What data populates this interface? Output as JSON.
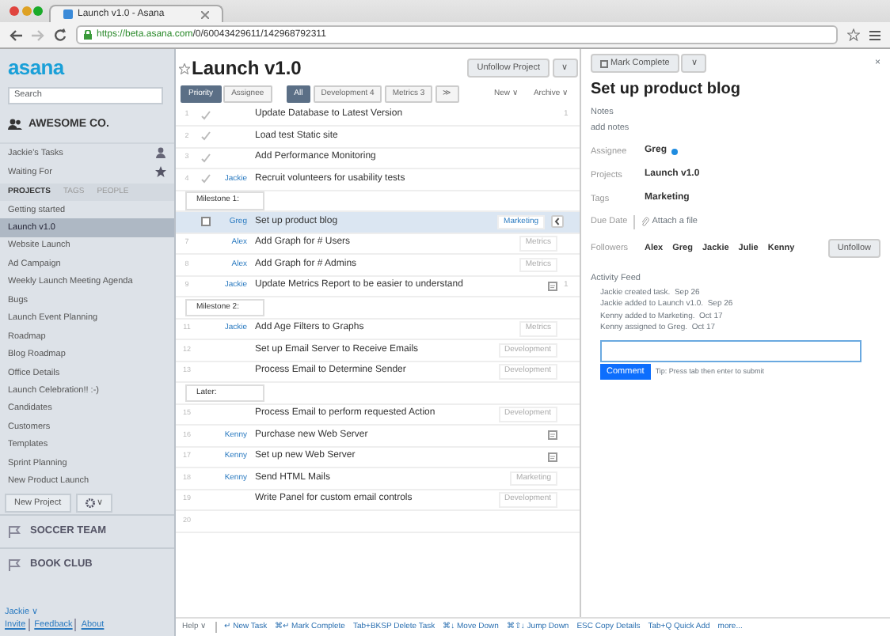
{
  "browser": {
    "tab_title": "Launch v1.0 - Asana",
    "url_host": "https://beta.asana.com",
    "url_path": "/0/60043429611/142968792311"
  },
  "sidebar": {
    "logo": "asana",
    "search": {
      "placeholder": "Search"
    },
    "workspace": "AWESOME CO.",
    "links": [
      {
        "label": "Jackie's Tasks"
      },
      {
        "label": "Waiting For"
      }
    ],
    "tabs": [
      {
        "label": "PROJECTS",
        "selected": true
      },
      {
        "label": "TAGS",
        "selected": false
      },
      {
        "label": "PEOPLE",
        "selected": false
      }
    ],
    "projects": [
      {
        "label": "Getting started",
        "selected": false
      },
      {
        "label": "Launch v1.0",
        "selected": true
      },
      {
        "label": "Website Launch",
        "selected": false
      },
      {
        "label": "Ad Campaign",
        "selected": false
      },
      {
        "label": "Weekly Launch Meeting Agenda",
        "selected": false
      },
      {
        "label": "Bugs",
        "selected": false
      },
      {
        "label": "Launch Event Planning",
        "selected": false
      },
      {
        "label": "Roadmap",
        "selected": false
      },
      {
        "label": "Blog Roadmap",
        "selected": false
      },
      {
        "label": "Office Details",
        "selected": false
      },
      {
        "label": "Launch Celebration!! :-)",
        "selected": false
      },
      {
        "label": "Candidates",
        "selected": false
      },
      {
        "label": "Customers",
        "selected": false
      },
      {
        "label": "Templates",
        "selected": false
      },
      {
        "label": "Sprint Planning",
        "selected": false
      },
      {
        "label": "New Product Launch",
        "selected": false
      }
    ],
    "new_project": "New Project",
    "gear_caret": "∨",
    "other_workspaces": [
      "SOCCER TEAM",
      "BOOK CLUB"
    ],
    "user": "Jackie ∨",
    "footer_links": [
      "Invite",
      "Feedback",
      "About"
    ]
  },
  "project": {
    "title": "Launch v1.0",
    "follow_button": "Unfollow Project",
    "menu_caret": "∨",
    "sort": [
      {
        "label": "Priority",
        "selected": true
      },
      {
        "label": "Assignee",
        "selected": false
      }
    ],
    "filters": [
      {
        "label": "All",
        "selected": true
      },
      {
        "label": "Development 4",
        "selected": false
      },
      {
        "label": "Metrics 3",
        "selected": false
      }
    ],
    "more": "≫",
    "actions": [
      "New ∨",
      "Archive ∨"
    ],
    "rows": [
      {
        "kind": "task",
        "number": "1",
        "checkmark": true,
        "selected": false,
        "assignee": "",
        "name": "Update Database to Latest Version",
        "tag": "",
        "attachment": false,
        "count": "1"
      },
      {
        "kind": "task",
        "number": "2",
        "checkmark": true,
        "selected": false,
        "assignee": "",
        "name": "Load test Static site",
        "tag": "",
        "attachment": false,
        "count": ""
      },
      {
        "kind": "task",
        "number": "3",
        "checkmark": true,
        "selected": false,
        "assignee": "",
        "name": "Add Performance Monitoring",
        "tag": "",
        "attachment": false,
        "count": ""
      },
      {
        "kind": "task",
        "number": "4",
        "checkmark": true,
        "selected": false,
        "assignee": "Jackie",
        "name": "Recruit volunteers for usability tests",
        "tag": "",
        "attachment": false,
        "count": ""
      },
      {
        "kind": "section",
        "name": "Milestone 1:"
      },
      {
        "kind": "task",
        "number": "",
        "checkmark": false,
        "selected": true,
        "assignee": "Greg",
        "name": "Set up product blog",
        "tag": "Marketing",
        "attachment": false,
        "count": ""
      },
      {
        "kind": "task",
        "number": "7",
        "checkmark": false,
        "selected": false,
        "assignee": "Alex",
        "name": "Add Graph for # Users",
        "tag": "Metrics",
        "attachment": false,
        "count": ""
      },
      {
        "kind": "task",
        "number": "8",
        "checkmark": false,
        "selected": false,
        "assignee": "Alex",
        "name": "Add Graph for # Admins",
        "tag": "Metrics",
        "attachment": false,
        "count": ""
      },
      {
        "kind": "task",
        "number": "9",
        "checkmark": false,
        "selected": false,
        "assignee": "Jackie",
        "name": "Update Metrics Report to be easier to understand",
        "tag": "",
        "attachment": true,
        "count": "1"
      },
      {
        "kind": "section",
        "name": "Milestone 2:"
      },
      {
        "kind": "task",
        "number": "11",
        "checkmark": false,
        "selected": false,
        "assignee": "Jackie",
        "name": "Add Age Filters to Graphs",
        "tag": "Metrics",
        "attachment": false,
        "count": ""
      },
      {
        "kind": "task",
        "number": "12",
        "checkmark": false,
        "selected": false,
        "assignee": "",
        "name": "Set up Email Server to Receive Emails",
        "tag": "Development",
        "attachment": false,
        "count": ""
      },
      {
        "kind": "task",
        "number": "13",
        "checkmark": false,
        "selected": false,
        "assignee": "",
        "name": "Process Email to Determine Sender",
        "tag": "Development",
        "attachment": false,
        "count": ""
      },
      {
        "kind": "section",
        "name": "Later:"
      },
      {
        "kind": "task",
        "number": "15",
        "checkmark": false,
        "selected": false,
        "assignee": "",
        "name": "Process Email to perform requested Action",
        "tag": "Development",
        "attachment": false,
        "count": ""
      },
      {
        "kind": "task",
        "number": "16",
        "checkmark": false,
        "selected": false,
        "assignee": "Kenny",
        "name": "Purchase new Web Server",
        "tag": "",
        "attachment": true,
        "count": ""
      },
      {
        "kind": "task",
        "number": "17",
        "checkmark": false,
        "selected": false,
        "assignee": "Kenny",
        "name": "Set up new Web Server",
        "tag": "",
        "attachment": true,
        "count": ""
      },
      {
        "kind": "task",
        "number": "18",
        "checkmark": false,
        "selected": false,
        "assignee": "Kenny",
        "name": "Send HTML Mails",
        "tag": "Marketing",
        "attachment": false,
        "count": ""
      },
      {
        "kind": "task",
        "number": "19",
        "checkmark": false,
        "selected": false,
        "assignee": "",
        "name": "Write Panel for custom email controls",
        "tag": "Development",
        "attachment": false,
        "count": ""
      },
      {
        "kind": "task",
        "number": "20",
        "checkmark": false,
        "selected": false,
        "assignee": "",
        "name": "",
        "tag": "",
        "attachment": false,
        "count": ""
      }
    ]
  },
  "details": {
    "mark_complete": "Mark Complete",
    "caret": "∨",
    "close": "×",
    "title": "Set up product blog",
    "notes_label": "Notes",
    "notes_placeholder": "add notes",
    "assignee_label": "Assignee",
    "assignee": "Greg",
    "projects_label": "Projects",
    "project": "Launch v1.0",
    "tags_label": "Tags",
    "tag": "Marketing",
    "due_label": "Due Date",
    "attach": "Attach a file",
    "followers_label": "Followers",
    "followers": [
      "Alex",
      "Greg",
      "Jackie",
      "Julie",
      "Kenny"
    ],
    "unfollow": "Unfollow",
    "activity_label": "Activity Feed",
    "activity": [
      {
        "text": "Jackie created task.",
        "date": "Sep 26"
      },
      {
        "text": "Jackie added to Launch v1.0.",
        "date": "Sep 26"
      },
      {
        "text": "Kenny added to Marketing.",
        "date": "Oct 17"
      },
      {
        "text": "Kenny assigned to Greg.",
        "date": "Oct 17"
      }
    ],
    "comment_button": "Comment",
    "tip": "Tip: Press tab then enter to submit"
  },
  "shortcuts": {
    "help": "Help ∨",
    "items": [
      {
        "key": "↵",
        "label": "New Task"
      },
      {
        "key": "⌘↵",
        "label": "Mark Complete"
      },
      {
        "key": "Tab+BKSP",
        "label": "Delete Task"
      },
      {
        "key": "⌘↓",
        "label": "Move Down"
      },
      {
        "key": "⌘⇧↓",
        "label": "Jump Down"
      },
      {
        "key": "ESC",
        "label": "Copy Details"
      },
      {
        "key": "Tab+Q",
        "label": "Quick Add"
      }
    ],
    "more": "more..."
  }
}
